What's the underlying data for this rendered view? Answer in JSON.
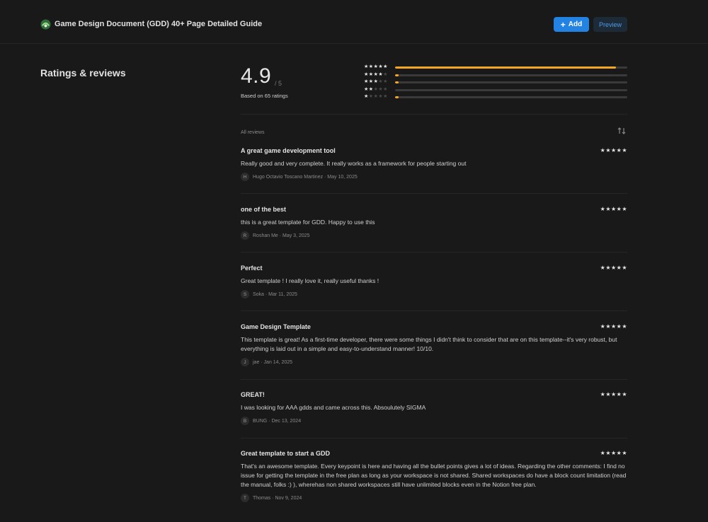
{
  "header": {
    "title": "Game Design Document (GDD) 40+ Page Detailed Guide",
    "add_label": "Add",
    "preview_label": "Preview",
    "logo_icon": "template-logo-icon"
  },
  "section_title": "Ratings & reviews",
  "summary": {
    "average": "4.9",
    "max": "/ 5",
    "based_on": "Based on 65 ratings",
    "distribution": [
      {
        "stars": 5,
        "fraction": 0.95
      },
      {
        "stars": 4,
        "fraction": 0.015
      },
      {
        "stars": 3,
        "fraction": 0.015
      },
      {
        "stars": 2,
        "fraction": 0
      },
      {
        "stars": 1,
        "fraction": 0.015
      }
    ],
    "bar_color": "#f5a623"
  },
  "reviews_header": {
    "label": "All reviews",
    "sort_icon": "sort-arrows-icon"
  },
  "reviews": [
    {
      "title": "A great game development tool",
      "rating": 5,
      "body": "Really good and very complete. It really works as a framework for people starting out",
      "initial": "H",
      "meta": "Hugo Octavio Toscano Martinez · May 10, 2025"
    },
    {
      "title": "one of the best",
      "rating": 5,
      "body": "this is a great template for GDD. Happy to use this",
      "initial": "R",
      "meta": "Roshan Me · May 3, 2025"
    },
    {
      "title": "Perfect",
      "rating": 5,
      "body": "Great template ! I really love it, really useful thanks !",
      "initial": "S",
      "meta": "Soka · Mar 11, 2025"
    },
    {
      "title": "Game Design Template",
      "rating": 5,
      "body": "This template is great! As a first-time developer, there were some things I didn't think to consider that are on this template--it's very robust, but everything is laid out in a simple and easy-to-understand manner! 10/10.",
      "initial": "J",
      "meta": "jae · Jan 14, 2025"
    },
    {
      "title": "GREAT!",
      "rating": 5,
      "body": "I was looking for AAA gdds and came across this. Absoulutely SIGMA",
      "initial": "B",
      "meta": "BUNG · Dec 13, 2024"
    },
    {
      "title": "Great template to start a GDD",
      "rating": 5,
      "body": "That's an awesome template. Every keypoint is here and having all the bullet points gives a lot of ideas. Regarding the other comments: I find no issue for getting the template in the free plan as long as your workspace is not shared. Shared workspaces do have a block count limitation (read the manual, folks :) ), wherehas non shared workspaces still have unlimited blocks even in the Notion free plan.",
      "initial": "T",
      "meta": "Thomas · Nov 9, 2024"
    }
  ]
}
